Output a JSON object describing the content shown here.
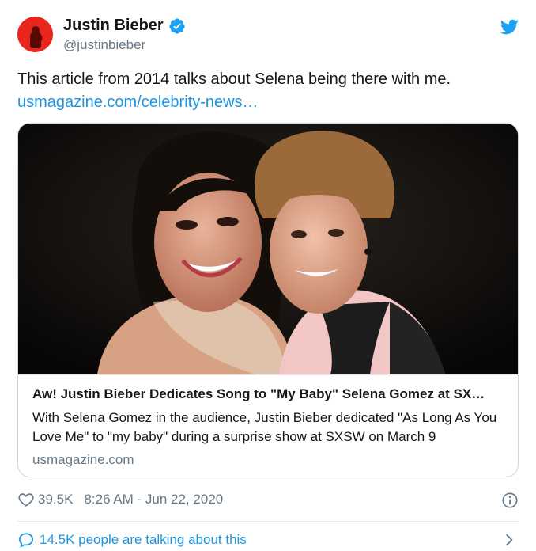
{
  "author": {
    "display_name": "Justin Bieber",
    "handle": "@justinbieber",
    "verified": true,
    "avatar_color": "#e8261c"
  },
  "tweet": {
    "text": "This article from 2014 talks about Selena being there with me.",
    "link": "usmagazine.com/celebrity-news…"
  },
  "card": {
    "image_icon": "photo-of-two-people",
    "title": "Aw! Justin Bieber Dedicates Song to \"My Baby\" Selena Gomez at SX…",
    "description": "With Selena Gomez in the audience, Justin Bieber dedicated \"As Long As You Love Me\" to \"my baby\" during a surprise show at SXSW on March 9",
    "domain": "usmagazine.com"
  },
  "meta": {
    "likes": "39.5K",
    "timestamp": "8:26 AM - Jun 22, 2020"
  },
  "footer": {
    "conversation": "14.5K people are talking about this"
  },
  "colors": {
    "twitter_blue": "#1da1f2",
    "link_blue": "#1b95e0",
    "secondary_text": "#657786",
    "border": "#ccd6dd"
  },
  "icons": {
    "brand": "twitter-bird-icon",
    "verified": "verified-badge-icon",
    "like": "heart-icon",
    "info": "info-icon",
    "reply": "speech-bubble-icon",
    "more": "chevron-right-icon"
  }
}
